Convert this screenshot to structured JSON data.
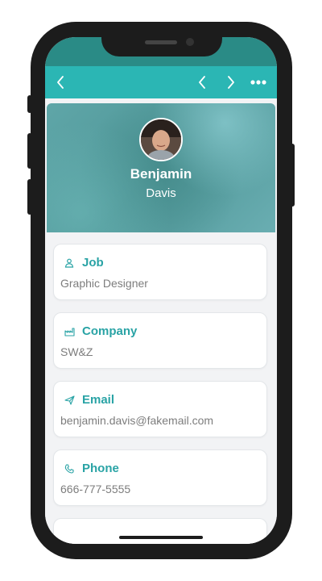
{
  "colors": {
    "status_bar": "#2a8b86",
    "nav_bar": "#2bb6b4",
    "accent_teal": "#29a3a5",
    "value_gray": "#7d7d7d",
    "phone_frame": "#1c1c1c"
  },
  "nav": {
    "back_icon": "chevron-left-icon",
    "prev_icon": "chevron-left-icon",
    "next_icon": "chevron-right-icon",
    "more_icon": "more-horizontal-icon"
  },
  "profile": {
    "first_name": "Benjamin",
    "last_name": "Davis",
    "avatar_icon": "user-photo"
  },
  "fields": [
    {
      "icon": "person-icon",
      "label": "Job",
      "value": "Graphic Designer"
    },
    {
      "icon": "factory-icon",
      "label": "Company",
      "value": "SW&Z"
    },
    {
      "icon": "send-icon",
      "label": "Email",
      "value": "benjamin.davis@fakemail.com"
    },
    {
      "icon": "phone-icon",
      "label": "Phone",
      "value": "666-777-5555"
    }
  ]
}
